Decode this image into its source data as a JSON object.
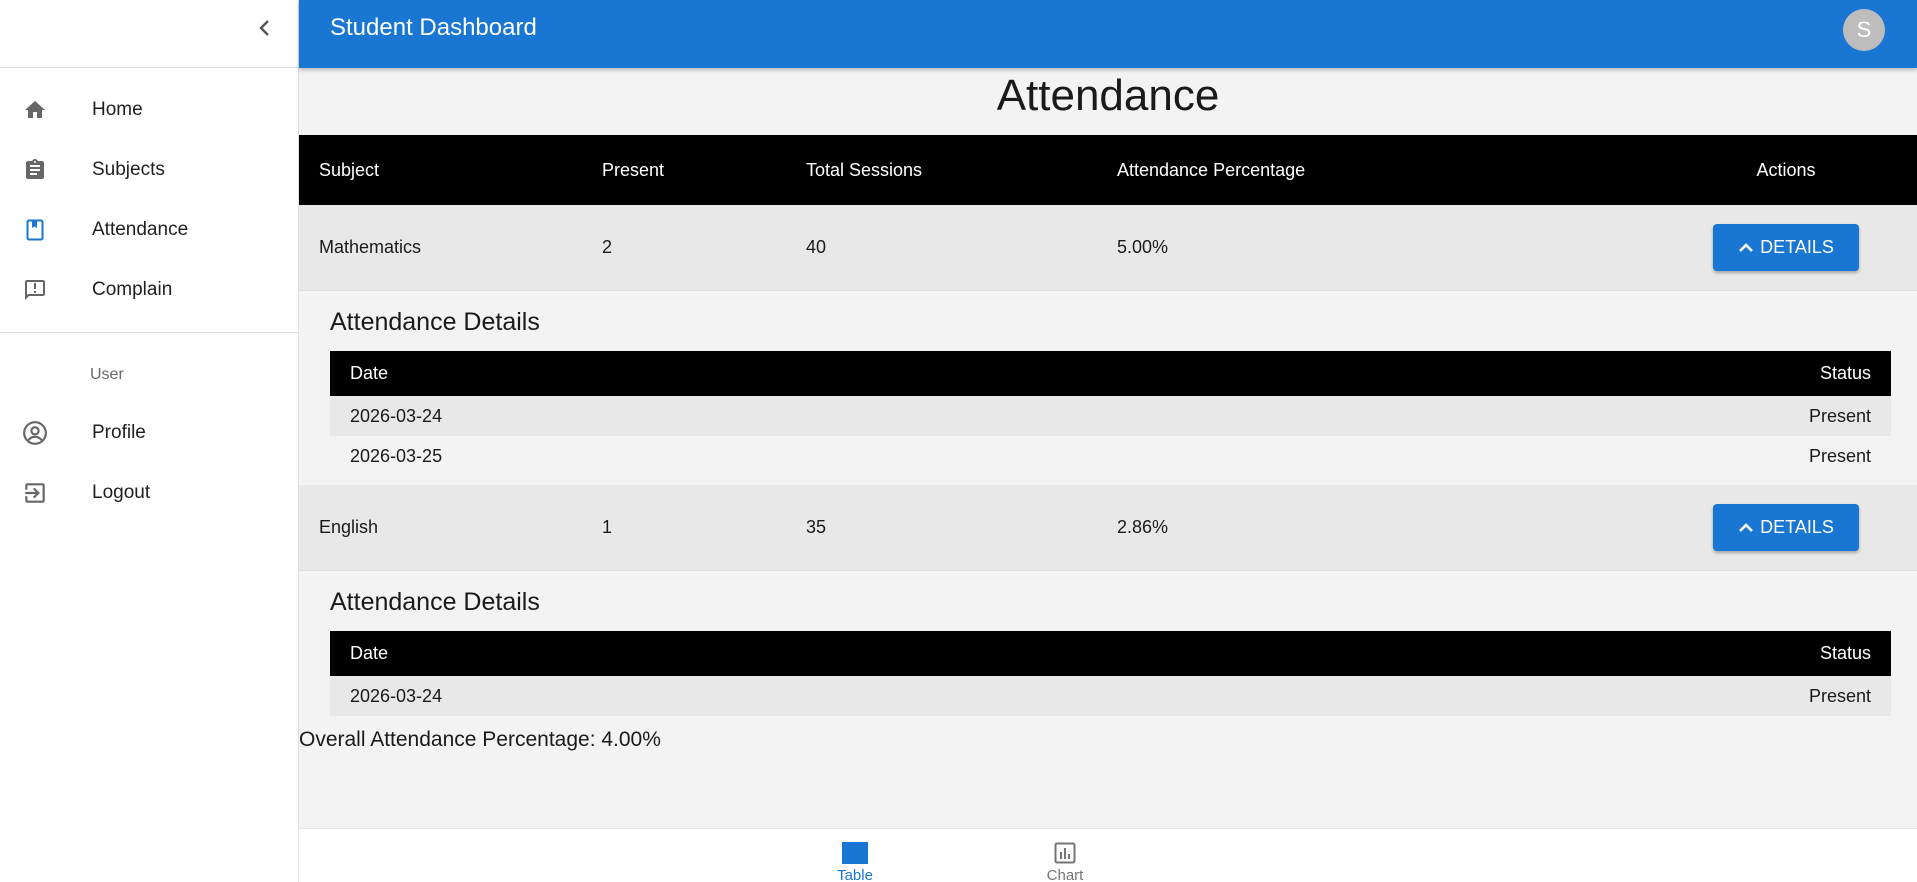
{
  "app": {
    "title": "Student Dashboard",
    "avatar_letter": "S"
  },
  "sidebar": {
    "items": [
      {
        "label": "Home",
        "icon": "home-icon"
      },
      {
        "label": "Subjects",
        "icon": "assignment-icon"
      },
      {
        "label": "Attendance",
        "icon": "bookmark-icon"
      },
      {
        "label": "Complain",
        "icon": "feedback-icon"
      }
    ],
    "section_header": "User",
    "user_items": [
      {
        "label": "Profile",
        "icon": "account-circle-icon"
      },
      {
        "label": "Logout",
        "icon": "logout-icon"
      }
    ]
  },
  "main": {
    "title": "Attendance",
    "table": {
      "headers": [
        "Subject",
        "Present",
        "Total Sessions",
        "Attendance Percentage",
        "Actions"
      ],
      "rows": [
        {
          "subject": "Mathematics",
          "present": "2",
          "total": "40",
          "percentage": "5.00%",
          "action_label": "DETAILS",
          "details": {
            "title": "Attendance Details",
            "headers": [
              "Date",
              "Status"
            ],
            "rows": [
              {
                "date": "2026-03-24",
                "status": "Present"
              },
              {
                "date": "2026-03-25",
                "status": "Present"
              }
            ]
          }
        },
        {
          "subject": "English",
          "present": "1",
          "total": "35",
          "percentage": "2.86%",
          "action_label": "DETAILS",
          "details": {
            "title": "Attendance Details",
            "headers": [
              "Date",
              "Status"
            ],
            "rows": [
              {
                "date": "2026-03-24",
                "status": "Present"
              }
            ]
          }
        }
      ]
    },
    "overall": "Overall Attendance Percentage: 4.00%"
  },
  "bottom_nav": {
    "items": [
      {
        "label": "Table",
        "icon": "table-icon",
        "active": true
      },
      {
        "label": "Chart",
        "icon": "bar-chart-icon",
        "active": false
      }
    ]
  },
  "colors": {
    "primary": "#1976d2",
    "header_bg": "#000000",
    "row_bg": "#e8e8e8",
    "page_bg": "#f3f3f3"
  }
}
